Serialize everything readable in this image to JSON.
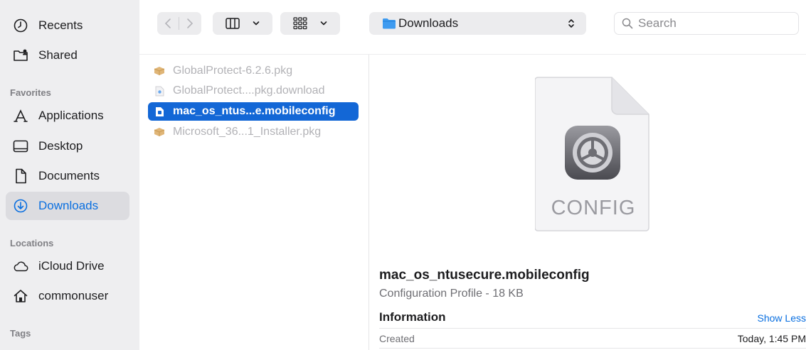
{
  "sidebar": {
    "recents": "Recents",
    "shared": "Shared",
    "favorites_heading": "Favorites",
    "applications": "Applications",
    "desktop": "Desktop",
    "documents": "Documents",
    "downloads": "Downloads",
    "locations_heading": "Locations",
    "icloud": "iCloud Drive",
    "home": "commonuser",
    "tags_heading": "Tags"
  },
  "toolbar": {
    "path": "Downloads",
    "search_placeholder": "Search"
  },
  "files": [
    {
      "name": "GlobalProtect-6.2.6.pkg",
      "icon": "package-icon"
    },
    {
      "name": "GlobalProtect....pkg.download",
      "icon": "download-file-icon"
    },
    {
      "name": "mac_os_ntus...e.mobileconfig",
      "icon": "document-icon"
    },
    {
      "name": "Microsoft_36...1_Installer.pkg",
      "icon": "package-icon"
    }
  ],
  "preview": {
    "doc_label": "CONFIG",
    "file_name": "mac_os_ntusecure.mobileconfig",
    "kind": "Configuration Profile - 18 KB",
    "info_heading": "Information",
    "show_less": "Show Less",
    "created_label": "Created",
    "created_value": "Today, 1:45 PM"
  },
  "colors": {
    "accent": "#0a6fe0",
    "selection": "#1367d6",
    "sidebar_bg": "#eeeef0"
  }
}
